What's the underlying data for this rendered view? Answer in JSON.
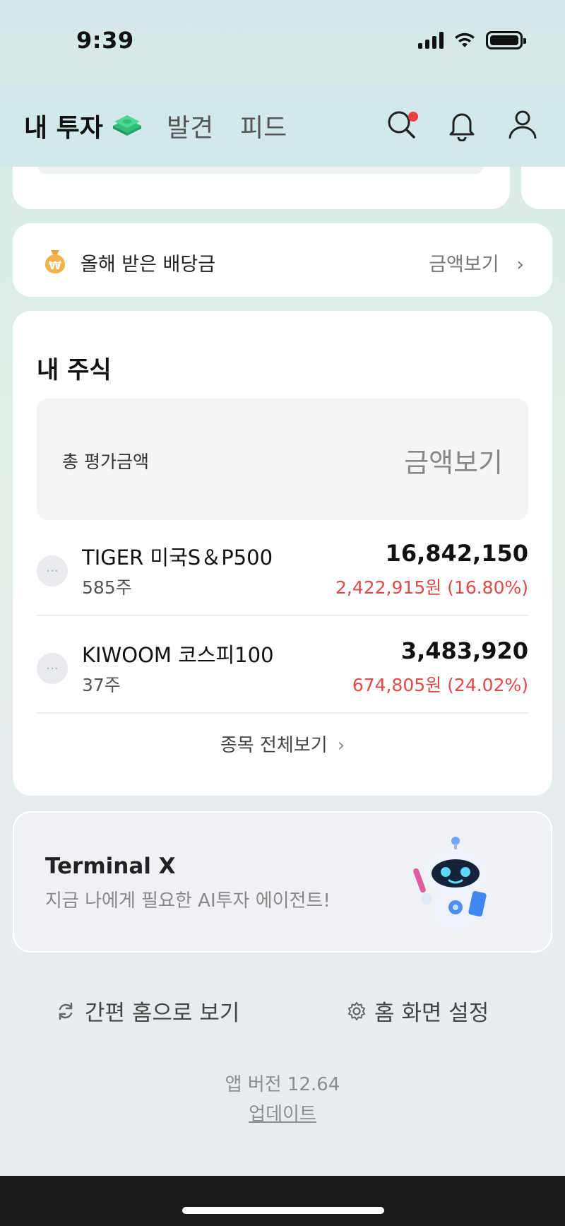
{
  "status_bar": {
    "time": "9:39"
  },
  "nav": {
    "tabs": [
      "내 투자",
      "발견",
      "피드"
    ],
    "icons": [
      "money-icon",
      "search-icon",
      "bell-icon",
      "profile-icon"
    ],
    "notification_dot_color": "#e8413e"
  },
  "dividend": {
    "label": "올해 받은 배당금",
    "link": "금액보기",
    "icon": "money-bag-icon"
  },
  "stocks": {
    "title": "내 주식",
    "total_label": "총 평가금액",
    "total_value": "금액보기",
    "items": [
      {
        "name": "TIGER 미국S＆P500",
        "qty": "585주",
        "value": "16,842,150",
        "change": "2,422,915원  (16.80%)"
      },
      {
        "name": "KIWOOM 코스피100",
        "qty": "37주",
        "value": "3,483,920",
        "change": "674,805원  (24.02%)"
      }
    ],
    "see_all": "종목 전체보기",
    "up_color": "#e04a47"
  },
  "terminal": {
    "title": "Terminal X",
    "subtitle": "지금 나에게 필요한 AI투자 에이전트!"
  },
  "footer": {
    "simple_home": "간편 홈으로 보기",
    "home_settings": "홈 화면 설정",
    "version": "앱 버전 12.64",
    "update": "업데이트"
  }
}
